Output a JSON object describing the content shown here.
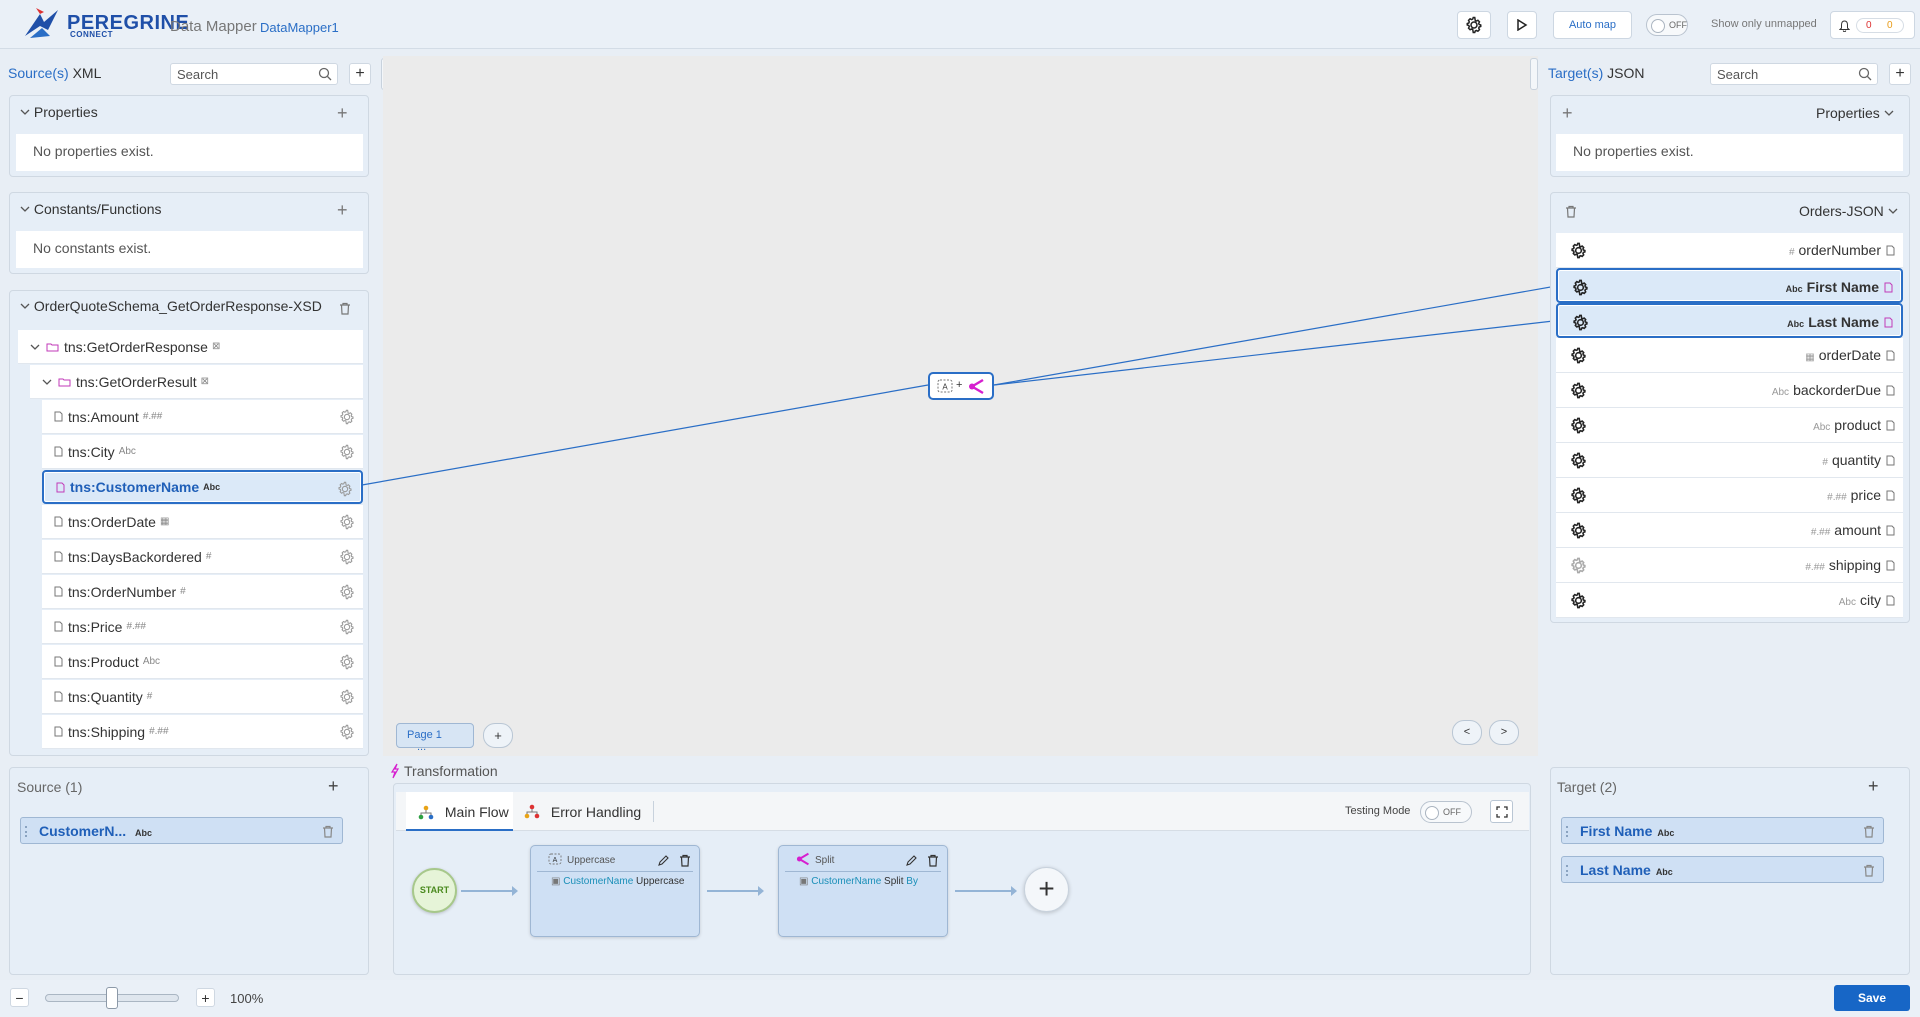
{
  "header": {
    "brand": "PEREGRINE",
    "brand_sub": "CONNECT",
    "app_name": "Data Mapper",
    "doc_name": "DataMapper1",
    "auto_map": "Auto map",
    "unmapped_toggle": "OFF",
    "unmapped_label": "Show only unmapped",
    "notif_red": "0",
    "notif_orange": "0"
  },
  "source": {
    "title": "Source(s)",
    "format": "XML",
    "search_placeholder": "Search",
    "properties_title": "Properties",
    "properties_empty": "No properties exist.",
    "constants_title": "Constants/Functions",
    "constants_empty": "No constants exist.",
    "schema_title": "OrderQuoteSchema_GetOrderResponse-XSD",
    "root": "tns:GetOrderResponse",
    "child": "tns:GetOrderResult",
    "fields": [
      {
        "name": "tns:Amount",
        "type": "#.##"
      },
      {
        "name": "tns:City",
        "type": "Abc"
      },
      {
        "name": "tns:CustomerName",
        "type": "Abc"
      },
      {
        "name": "tns:OrderDate",
        "type": "▦"
      },
      {
        "name": "tns:DaysBackordered",
        "type": "#"
      },
      {
        "name": "tns:OrderNumber",
        "type": "#"
      },
      {
        "name": "tns:Price",
        "type": "#.##"
      },
      {
        "name": "tns:Product",
        "type": "Abc"
      },
      {
        "name": "tns:Quantity",
        "type": "#"
      },
      {
        "name": "tns:Shipping",
        "type": "#.##"
      }
    ]
  },
  "target": {
    "title": "Target(s)",
    "format": "JSON",
    "search_placeholder": "Search",
    "properties_title": "Properties",
    "properties_empty": "No properties exist.",
    "schema_title": "Orders-JSON",
    "fields": [
      {
        "name": "orderNumber",
        "type": "#"
      },
      {
        "name": "First Name",
        "type": "Abc"
      },
      {
        "name": "Last Name",
        "type": "Abc"
      },
      {
        "name": "orderDate",
        "type": "▦"
      },
      {
        "name": "backorderDue",
        "type": "Abc"
      },
      {
        "name": "product",
        "type": "Abc"
      },
      {
        "name": "quantity",
        "type": "#"
      },
      {
        "name": "price",
        "type": "#.##"
      },
      {
        "name": "amount",
        "type": "#.##"
      },
      {
        "name": "shipping",
        "type": "#.##"
      },
      {
        "name": "city",
        "type": "Abc"
      }
    ]
  },
  "canvas": {
    "page_label": "Page 1",
    "page_more": "...",
    "add_page": "+",
    "prev": "<",
    "next": ">"
  },
  "bottom": {
    "source_title": "Source (1)",
    "source_chip": "CustomerN...",
    "source_chip_type": "Abc",
    "transformation_title": "Transformation",
    "tab_main": "Main Flow",
    "tab_error": "Error Handling",
    "testing_mode": "Testing Mode",
    "testing_toggle": "OFF",
    "start": "START",
    "step1_title": "Uppercase",
    "step1_field": "CustomerName",
    "step1_op": "Uppercase",
    "step2_title": "Split",
    "step2_field": "CustomerName",
    "step2_op": "Split",
    "step2_by": "By",
    "target_title": "Target (2)",
    "target_chips": [
      {
        "name": "First Name",
        "type": "Abc"
      },
      {
        "name": "Last Name",
        "type": "Abc"
      }
    ]
  },
  "footer": {
    "zoom": "100%",
    "save": "Save"
  },
  "colors": {
    "accent": "#2a6ec6",
    "save": "#1766c6",
    "split_icon": "#d61fcf"
  }
}
